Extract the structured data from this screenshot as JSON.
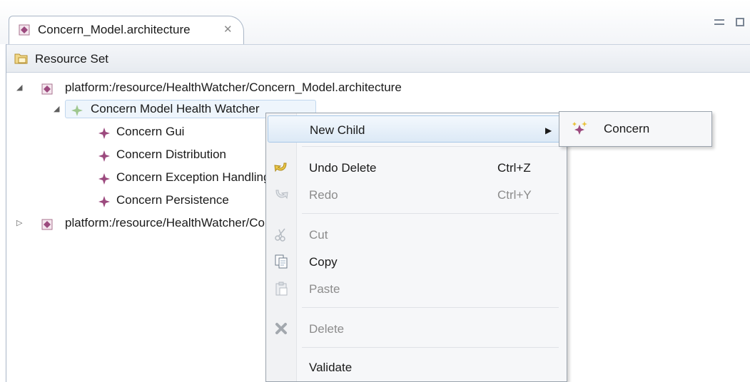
{
  "editor_tab": {
    "label": "Concern_Model.architecture",
    "close_glyph": "✕"
  },
  "header": {
    "label": "Resource Set"
  },
  "tree": {
    "root1": {
      "label": "platform:/resource/HealthWatcher/Concern_Model.architecture",
      "expanded": true
    },
    "model": {
      "label": "Concern Model Health Watcher",
      "expanded": true,
      "selected": true
    },
    "children": [
      {
        "label": "Concern Gui"
      },
      {
        "label": "Concern Distribution"
      },
      {
        "label": "Concern Exception Handling"
      },
      {
        "label": "Concern Persistence"
      }
    ],
    "root2": {
      "label": "platform:/resource/HealthWatcher/Components_Model.architecture",
      "expanded": false
    }
  },
  "context_menu": {
    "new_child": {
      "label": "New Child",
      "arrow": "▶"
    },
    "undo": {
      "label": "Undo Delete",
      "accel": "Ctrl+Z"
    },
    "redo": {
      "label": "Redo",
      "accel": "Ctrl+Y"
    },
    "cut": {
      "label": "Cut"
    },
    "copy": {
      "label": "Copy"
    },
    "paste": {
      "label": "Paste"
    },
    "delete": {
      "label": "Delete"
    },
    "validate": {
      "label": "Validate"
    }
  },
  "submenu": {
    "concern": {
      "label": "Concern"
    }
  },
  "icons": {
    "model_file": "architecture-file-icon",
    "resource_set": "resource-set-icon",
    "element": "concern-element-icon",
    "undo": "undo-icon",
    "redo": "redo-icon",
    "cut": "scissors-icon",
    "copy": "copy-icon",
    "paste": "paste-icon",
    "delete": "delete-x-icon",
    "new_concern": "new-concern-icon"
  },
  "colors": {
    "element_icon": "#9c4a7e",
    "selection_bg": "#eef5fc",
    "menu_hover": "#dce9f6",
    "disabled_text": "#8c8c8c"
  }
}
